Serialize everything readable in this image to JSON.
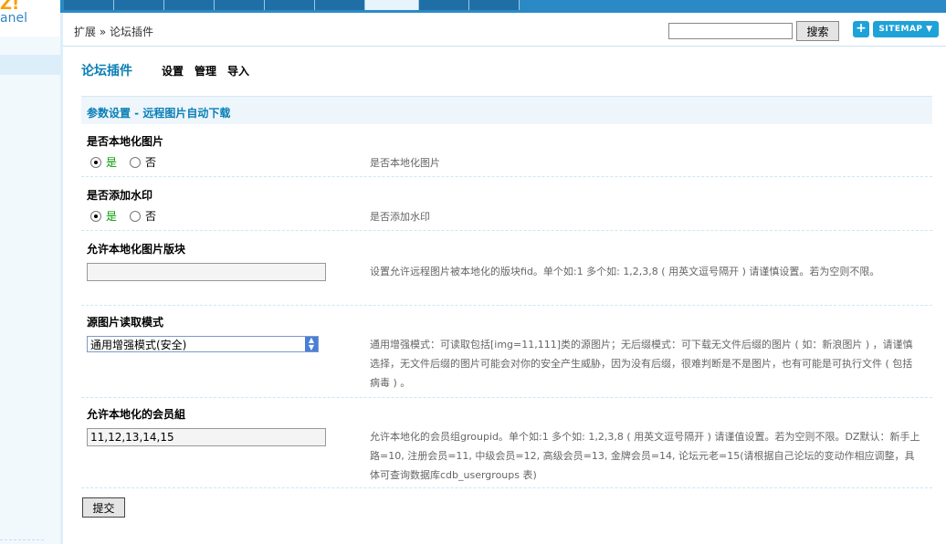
{
  "logo": {
    "brand": "Z!",
    "panel": "anel"
  },
  "header": {
    "breadcrumb": "扩展 » 论坛插件",
    "search_placeholder": "",
    "search_button": "搜索",
    "plus_label": "+",
    "sitemap_label": "SITEMAP ▼"
  },
  "page": {
    "title": "论坛插件",
    "subnav": [
      "设置",
      "管理",
      "导入"
    ],
    "section_title": "参数设置 - 远程图片自动下载"
  },
  "settings": {
    "localize": {
      "label": "是否本地化图片",
      "yes": "是",
      "no": "否",
      "desc": "是否本地化图片"
    },
    "watermark": {
      "label": "是否添加水印",
      "yes": "是",
      "no": "否",
      "desc": "是否添加水印"
    },
    "forums": {
      "label": "允许本地化图片版块",
      "value": "",
      "desc": "设置允许远程图片被本地化的版块fid。单个如:1 多个如: 1,2,3,8 ( 用英文逗号隔开 )  请谨慎设置。若为空则不限。"
    },
    "read_mode": {
      "label": "源图片读取模式",
      "selected": "通用增强模式(安全)",
      "desc": "通用增强模式：可读取包括[img=11,111]类的源图片；无后缀模式：可下载无文件后缀的图片 ( 如：新浪图片 ) ，请谨慎选择，无文件后缀的图片可能会对你的安全产生威胁，因为没有后缀，很难判断是不是图片，也有可能是可执行文件 ( 包括病毒 ) 。"
    },
    "groups": {
      "label": "允许本地化的会员組",
      "value": "11,12,13,14,15",
      "desc": "允许本地化的会员组groupid。单个如:1 多个如: 1,2,3,8 ( 用英文逗号隔开 )  请谨值设置。若为空则不限。DZ默认：新手上路=10, 注册会员=11, 中级会员=12, 高级会员=13, 金牌会员=14, 论坛元老=15(请根据自己论坛的变动作相应调整，具体可查询数据库cdb_usergroups 表)"
    }
  },
  "submit_label": "提交",
  "colors": {
    "accent": "#0a7fb5",
    "topbar": "#2b8ac6",
    "yes": "#009900"
  }
}
